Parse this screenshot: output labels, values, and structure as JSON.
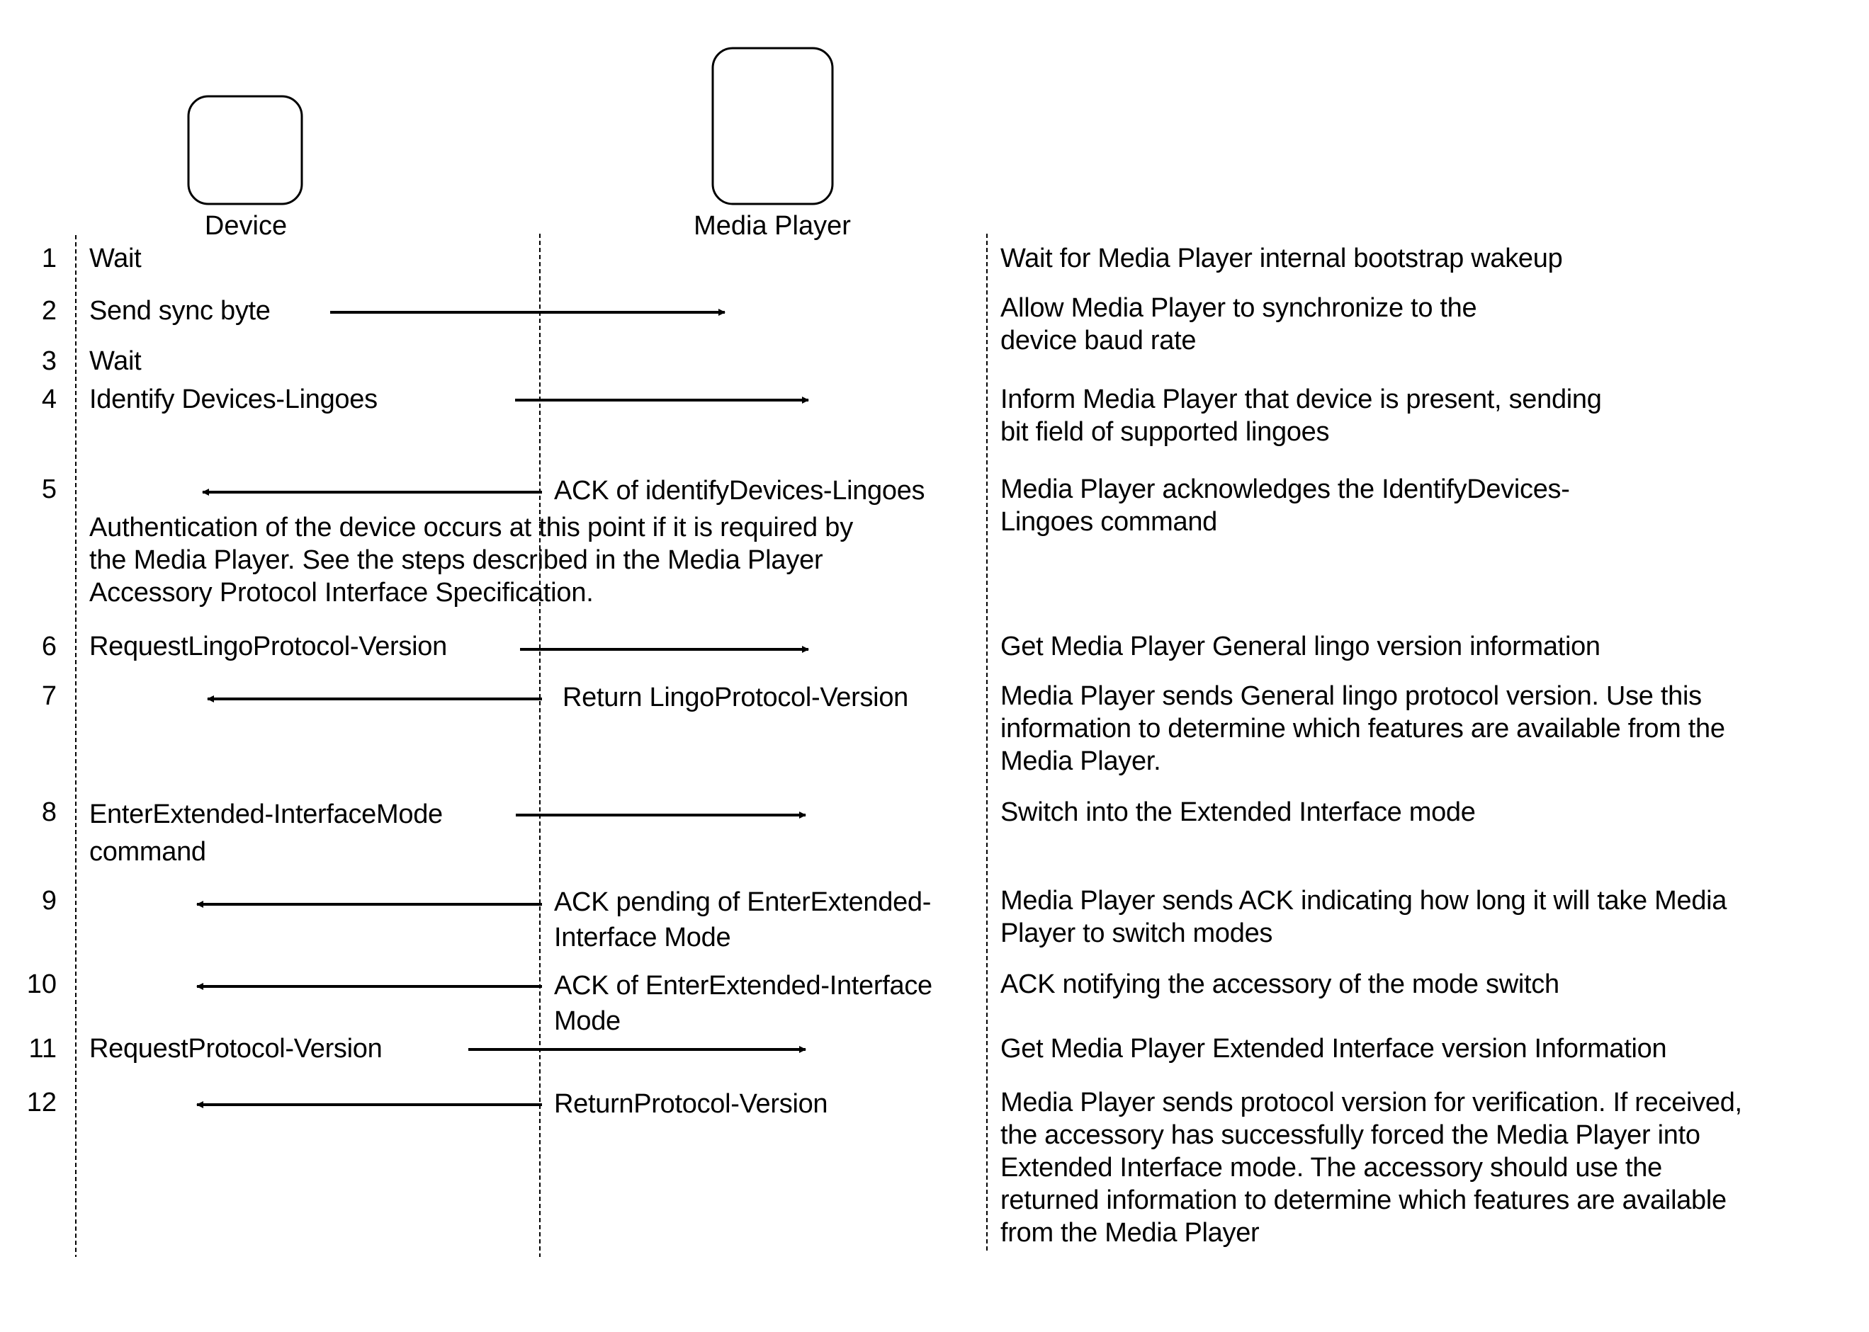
{
  "participants": {
    "device": {
      "label": "Device"
    },
    "media_player": {
      "label": "Media Player"
    }
  },
  "steps": [
    {
      "number": "1",
      "device_text": "Wait",
      "description": "Wait for Media Player internal bootstrap wakeup"
    },
    {
      "number": "2",
      "device_text": "Send sync byte",
      "direction": "device-to-player",
      "description": "Allow Media Player to synchronize to the\ndevice baud rate"
    },
    {
      "number": "3",
      "device_text": "Wait"
    },
    {
      "number": "4",
      "device_text": "Identify Devices-Lingoes",
      "direction": "device-to-player",
      "description": "Inform Media Player that device is present, sending\nbit field of supported lingoes"
    },
    {
      "number": "5",
      "message": "ACK of identifyDevices-Lingoes",
      "direction": "player-to-device",
      "description": "Media Player acknowledges the IdentifyDevices-\nLingoes command"
    },
    {
      "number": "6",
      "device_text": "RequestLingoProtocol-Version",
      "direction": "device-to-player",
      "description": "Get Media Player General lingo version information"
    },
    {
      "number": "7",
      "message": "Return LingoProtocol-Version",
      "direction": "player-to-device",
      "description": "Media Player sends General lingo protocol version. Use this\ninformation to determine which features are available from the\nMedia Player."
    },
    {
      "number": "8",
      "device_text": "EnterExtended-InterfaceMode\ncommand",
      "direction": "device-to-player",
      "description": "Switch into the Extended Interface mode"
    },
    {
      "number": "9",
      "message": "ACK pending of EnterExtended-\nInterface Mode",
      "direction": "player-to-device",
      "description": "Media Player sends ACK indicating how long it will take Media\nPlayer to switch modes"
    },
    {
      "number": "10",
      "message": "ACK of EnterExtended-Interface\nMode",
      "direction": "player-to-device",
      "description": "ACK notifying the accessory of the mode switch"
    },
    {
      "number": "11",
      "device_text": "RequestProtocol-Version",
      "direction": "device-to-player",
      "description": "Get Media Player Extended Interface version Information"
    },
    {
      "number": "12",
      "message": "ReturnProtocol-Version",
      "direction": "player-to-device",
      "description": "Media Player sends protocol version for verification. If received,\nthe accessory has successfully forced the Media Player into\nExtended Interface mode. The accessory should use the\nreturned information to determine which features are available\nfrom the Media Player"
    }
  ],
  "authentication_note": "Authentication of the device occurs at this point if it is required by\nthe Media Player. See the steps described in the Media Player\nAccessory Protocol Interface Specification."
}
